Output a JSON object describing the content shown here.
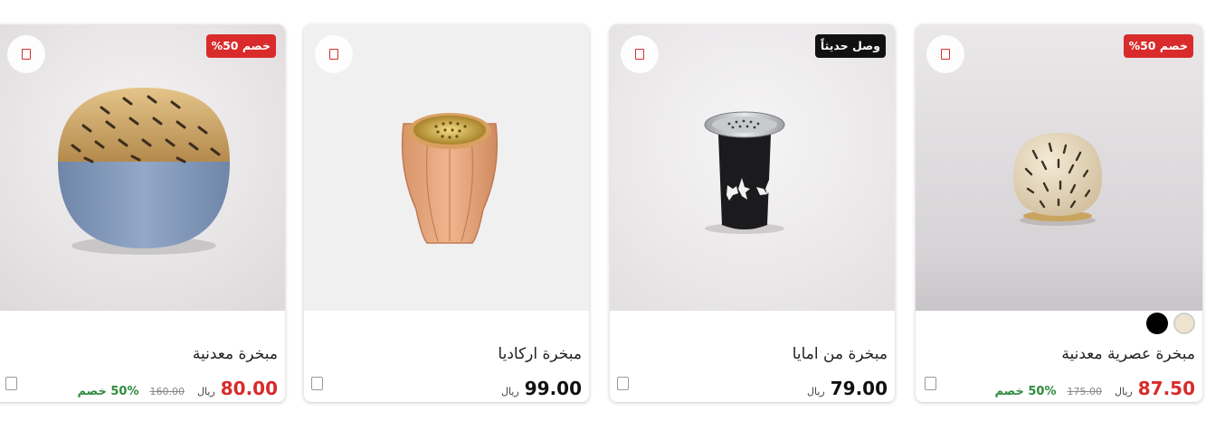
{
  "products": [
    {
      "name": "مبخرة معدنية",
      "price": "80.00",
      "currency": "ريال",
      "old_price": "160.00",
      "discount": "50% خصم",
      "badge": "خصم 50%",
      "badge_type": "sale"
    },
    {
      "name": "مبخرة اركاديا",
      "price": "99.00",
      "currency": "ريال"
    },
    {
      "name": "مبخرة من امايا",
      "price": "79.00",
      "currency": "ريال",
      "badge": "وصل حديثاً",
      "badge_type": "new"
    },
    {
      "name": "مبخرة عصرية معدنية",
      "price": "87.50",
      "currency": "ريال",
      "old_price": "175.00",
      "discount": "50% خصم",
      "badge": "خصم 50%",
      "badge_type": "sale",
      "color_swatches": [
        "#ece4cc",
        "#000000"
      ]
    }
  ],
  "colors": {
    "sale_red": "#d92b2b",
    "discount_green": "#2e8b3e",
    "new_badge": "#111111"
  },
  "icons": {
    "wishlist": "wishlist-icon",
    "compare": "compare-checkbox-icon"
  }
}
